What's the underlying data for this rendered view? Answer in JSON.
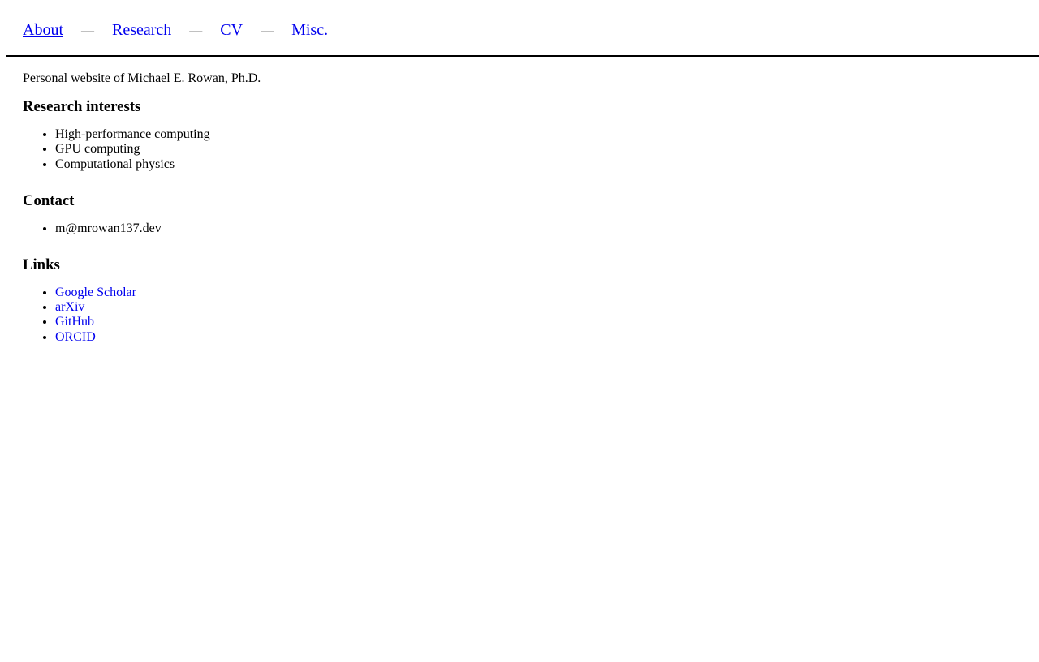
{
  "nav": {
    "separator": "—",
    "items": [
      {
        "label": "About",
        "current": true
      },
      {
        "label": "Research",
        "current": false
      },
      {
        "label": "CV",
        "current": false
      },
      {
        "label": "Misc.",
        "current": false
      }
    ]
  },
  "main": {
    "intro": "Personal website of Michael E. Rowan, Ph.D.",
    "sections": [
      {
        "heading": "Research interests",
        "items": [
          "High-performance computing",
          "GPU computing",
          "Computational physics"
        ]
      },
      {
        "heading": "Contact",
        "items": [
          "m@mrowan137.dev"
        ]
      },
      {
        "heading": "Links",
        "items": [
          "Google Scholar",
          "arXiv",
          "GitHub",
          "ORCID"
        ]
      }
    ]
  },
  "colors": {
    "link": "#0000EE",
    "text": "#000000",
    "rule": "#000000",
    "background": "#FFFFFF"
  }
}
